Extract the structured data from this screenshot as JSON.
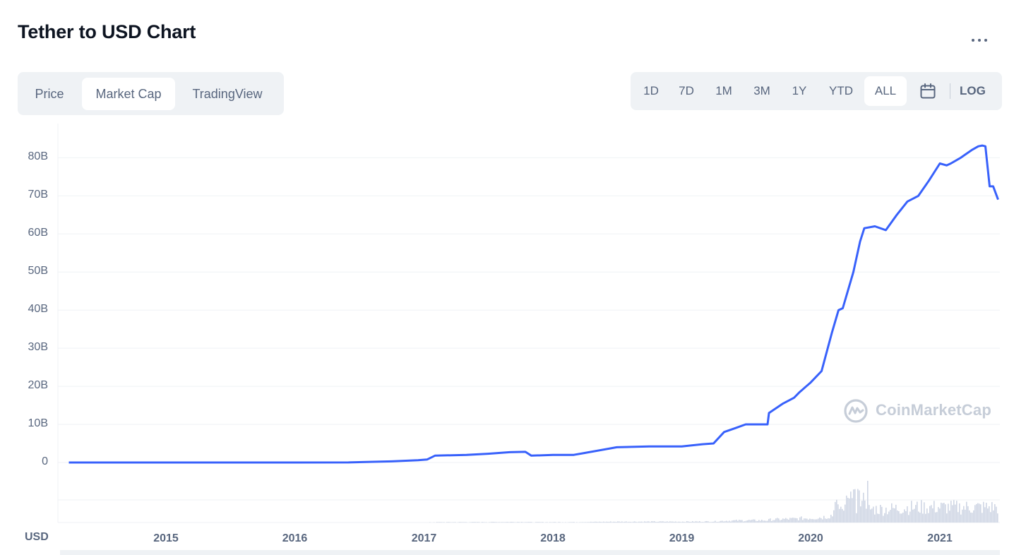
{
  "header": {
    "title": "Tether to USD Chart"
  },
  "tabs": [
    {
      "label": "Price",
      "active": false
    },
    {
      "label": "Market Cap",
      "active": true
    },
    {
      "label": "TradingView",
      "active": false
    }
  ],
  "ranges": [
    {
      "label": "1D",
      "active": false
    },
    {
      "label": "7D",
      "active": false
    },
    {
      "label": "1M",
      "active": false
    },
    {
      "label": "3M",
      "active": false
    },
    {
      "label": "1Y",
      "active": false
    },
    {
      "label": "YTD",
      "active": false
    },
    {
      "label": "ALL",
      "active": true
    }
  ],
  "log_label": "LOG",
  "watermark": "CoinMarketCap",
  "colors": {
    "line": "#3861fb",
    "volume": "#cfd6e4",
    "grid": "#eff2f5",
    "muted_text": "#58667e"
  },
  "chart_data": {
    "type": "line",
    "title": "Tether to USD Chart",
    "series": [
      {
        "name": "",
        "x": [
          "2014-04-01",
          "2015-01-01",
          "2016-01-01",
          "2016-06-01",
          "2016-10-01",
          "2016-12-15",
          "2017-01-10",
          "2017-02-01",
          "2017-05-01",
          "2017-07-01",
          "2017-09-01",
          "2017-10-15",
          "2017-11-01",
          "2018-01-01",
          "2018-03-01",
          "2018-04-01",
          "2018-07-01",
          "2018-10-01",
          "2019-01-01",
          "2019-03-01",
          "2019-04-01",
          "2019-05-01",
          "2019-06-01",
          "2019-07-01",
          "2019-08-01",
          "2019-09-01",
          "2019-09-05",
          "2019-10-15",
          "2019-11-15",
          "2019-12-01",
          "2020-01-01",
          "2020-02-01",
          "2020-03-01",
          "2020-03-20",
          "2020-04-01",
          "2020-05-01",
          "2020-05-20",
          "2020-06-01",
          "2020-07-01",
          "2020-08-01",
          "2020-09-01",
          "2020-10-01",
          "2020-11-01",
          "2020-12-01",
          "2021-01-01",
          "2021-01-20",
          "2021-02-01",
          "2021-03-01",
          "2021-04-01",
          "2021-04-20",
          "2021-05-01",
          "2021-05-10",
          "2021-05-18",
          "2021-05-22",
          "2021-06-01",
          "2021-06-15"
        ],
        "values": [
          0.0002,
          0.0002,
          0.001,
          0.02,
          0.3,
          0.6,
          0.8,
          1.8,
          2.0,
          2.3,
          2.7,
          2.8,
          1.8,
          2.0,
          2.0,
          2.5,
          4.0,
          4.2,
          4.2,
          4.8,
          5.0,
          8.0,
          9.0,
          10.0,
          10.0,
          10.0,
          13.0,
          15.5,
          17.0,
          18.5,
          21.0,
          24.0,
          34.0,
          40.0,
          40.5,
          50.0,
          58.0,
          61.5,
          62.0,
          61.0,
          65.0,
          68.5,
          70.0,
          74.0,
          78.5,
          78.0,
          78.5,
          80.0,
          82.0,
          83.0,
          83.2,
          83.0,
          76.0,
          72.5,
          72.5,
          69.0
        ]
      }
    ],
    "xlabel": "",
    "ylabel": "USD",
    "x_tick_labels": [
      "2015",
      "2016",
      "2017",
      "2018",
      "2019",
      "2020",
      "2021"
    ],
    "y_tick_labels": [
      "0",
      "10B",
      "20B",
      "30B",
      "40B",
      "50B",
      "60B",
      "70B",
      "80B"
    ],
    "y_tick_values": [
      0,
      10,
      20,
      30,
      40,
      50,
      60,
      70,
      80
    ],
    "y_unit": "billions USD",
    "xlim": [
      "2014-03-01",
      "2021-06-20"
    ],
    "ylim": [
      -3.5,
      88
    ],
    "grid": true,
    "legend": "none"
  }
}
